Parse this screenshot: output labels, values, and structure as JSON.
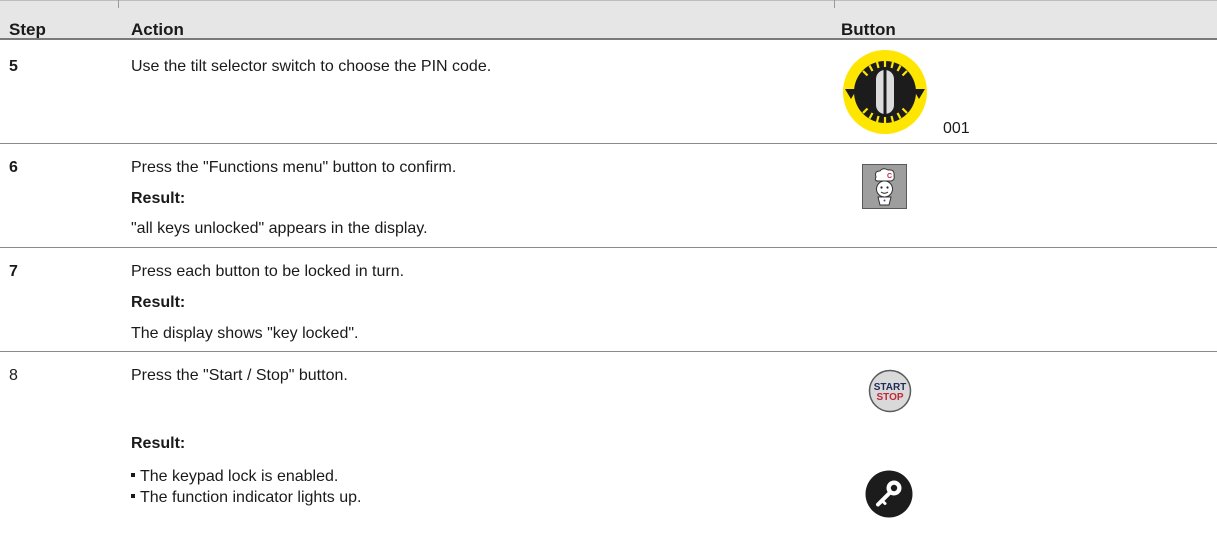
{
  "header": {
    "step": "Step",
    "action": "Action",
    "button": "Button"
  },
  "rows": [
    {
      "step": "5",
      "action": "Use the tilt selector switch to choose the PIN code.",
      "button_value": "001",
      "icon": "tilt-selector-switch-icon"
    },
    {
      "step": "6",
      "action": "Press the \"Functions menu\" button to confirm.",
      "result_label": "Result:",
      "result": "\"all keys unlocked\" appears in the display.",
      "icon": "functions-menu-chef-icon"
    },
    {
      "step": "7",
      "action": "Press each button to be locked in turn.",
      "result_label": "Result:",
      "result": "The display shows \"key locked\"."
    },
    {
      "step": "8",
      "action": "Press the \"Start / Stop\" button.",
      "result_label": "Result:",
      "results": [
        "The keypad lock is enabled.",
        "The function indicator lights up."
      ],
      "icon": "start-stop-button-icon",
      "icon2": "key-lock-indicator-icon",
      "start_text": "START",
      "stop_text": "STOP"
    }
  ],
  "colors": {
    "header_bg": "#e6e6e6",
    "rule": "#8a8a8a",
    "yellow": "#ffe600",
    "stop_red": "#c0283b",
    "start_navy": "#1f2a5a"
  }
}
